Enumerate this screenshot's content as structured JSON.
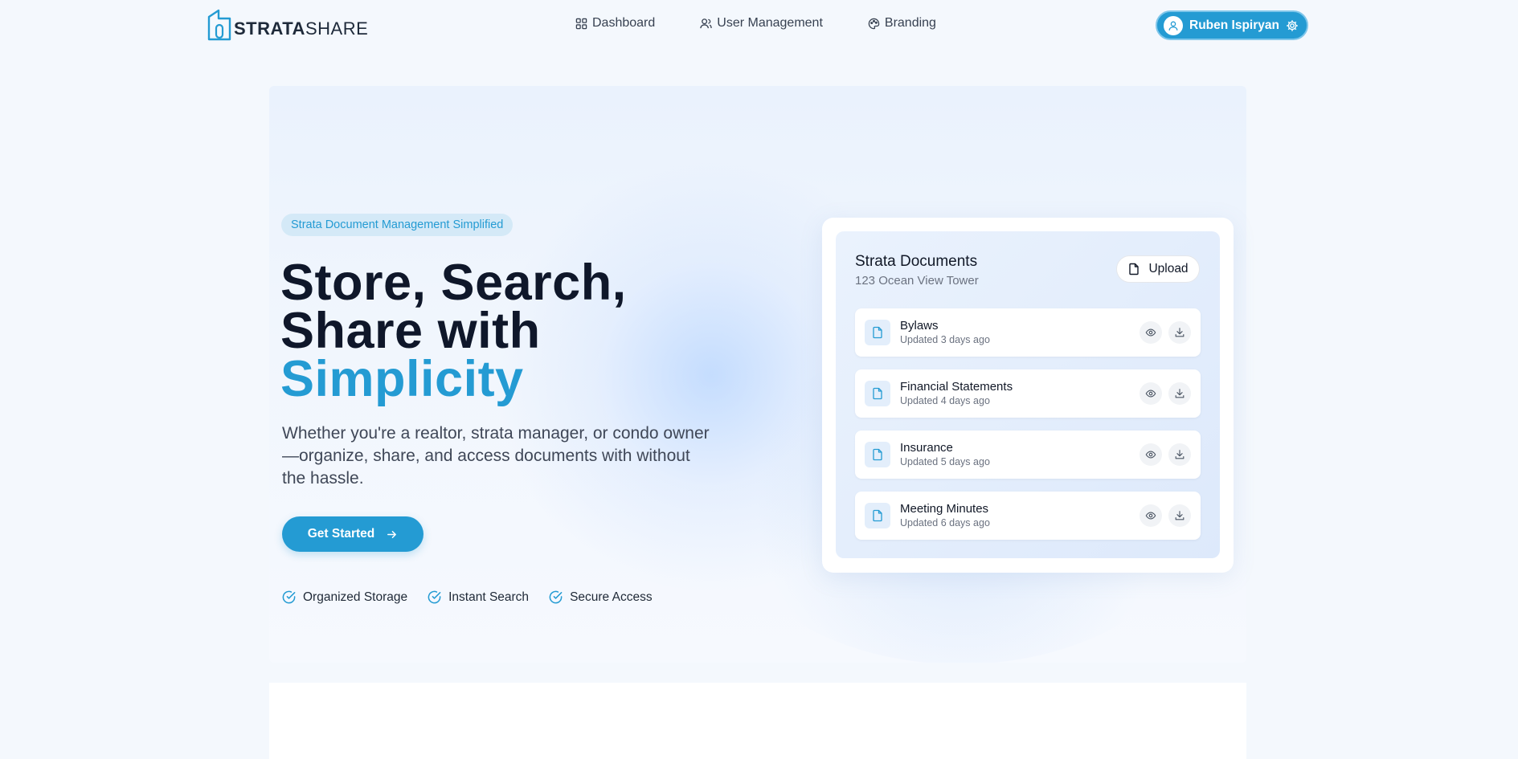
{
  "brand": {
    "logo_strong": "STRATA",
    "logo_light": "SHARE",
    "accent": "#249bd3"
  },
  "nav": {
    "links": [
      {
        "label": "Dashboard",
        "icon": "grid-icon"
      },
      {
        "label": "User Management",
        "icon": "users-icon"
      },
      {
        "label": "Branding",
        "icon": "palette-icon"
      }
    ],
    "user": {
      "name": "Ruben Ispiryan",
      "icon": "user-icon",
      "settings_icon": "gear-icon"
    }
  },
  "hero": {
    "tagline": "Strata Document Management Simplified",
    "headline_line1": "Store, Search,",
    "headline_line2": "Share with",
    "headline_accent": "Simplicity",
    "subtext": "Whether you're a realtor, strata manager, or condo owner—organize, share, and access documents with without the hassle.",
    "cta_label": "Get Started",
    "features": [
      "Organized Storage",
      "Instant Search",
      "Secure Access"
    ]
  },
  "documents": {
    "title": "Strata Documents",
    "subtitle": "123 Ocean View Tower",
    "upload_label": "Upload",
    "items": [
      {
        "name": "Bylaws",
        "updated": "Updated 3 days ago"
      },
      {
        "name": "Financial Statements",
        "updated": "Updated 4 days ago"
      },
      {
        "name": "Insurance",
        "updated": "Updated 5 days ago"
      },
      {
        "name": "Meeting Minutes",
        "updated": "Updated 6 days ago"
      }
    ]
  }
}
